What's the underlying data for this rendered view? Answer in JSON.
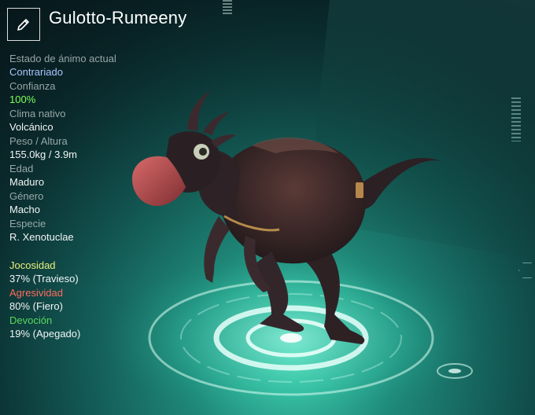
{
  "header": {
    "name": "Gulotto-Rumeeny",
    "edit_icon": "pencil-icon"
  },
  "stats": [
    {
      "label": "Estado de ánimo actual",
      "value": "Contrariado",
      "value_color": "#a9c6ff"
    },
    {
      "label": "Confianza",
      "value": "100%",
      "value_color": "#7dff5a"
    },
    {
      "label": "Clima nativo",
      "value": "Volcánico",
      "value_color": "#f2f5f5"
    },
    {
      "label": "Peso / Altura",
      "value": "155.0kg / 3.9m",
      "value_color": "#f2f5f5"
    },
    {
      "label": "Edad",
      "value": "Maduro",
      "value_color": "#f2f5f5"
    },
    {
      "label": "Género",
      "value": "Macho",
      "value_color": "#f2f5f5"
    },
    {
      "label": "Especie",
      "value": "R. Xenotuclae",
      "value_color": "#f2f5f5"
    }
  ],
  "traits": [
    {
      "label": "Jocosidad",
      "value": "37% (Travieso)",
      "label_color": "#e8f07a"
    },
    {
      "label": "Agresividad",
      "value": "80% (Fiero)",
      "label_color": "#ff6b5c"
    },
    {
      "label": "Devoción",
      "value": "19% (Apegado)",
      "label_color": "#5ad85a"
    }
  ],
  "scene": {
    "creature": "red-dinosaur-creature",
    "platform": "holographic-platform"
  }
}
